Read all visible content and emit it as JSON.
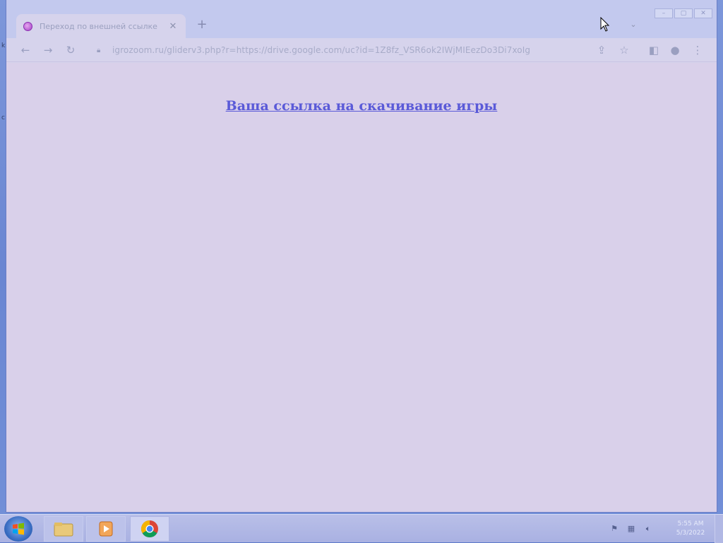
{
  "browser": {
    "tab": {
      "title": "Переход по внешней ссылке",
      "favicon_icon": "purple-circle-icon",
      "close_label": "✕"
    },
    "new_tab_label": "+",
    "tab_search_label": "⌄",
    "window_controls": {
      "minimize": "–",
      "maximize": "▢",
      "close": "✕"
    },
    "toolbar": {
      "back_label": "←",
      "forward_label": "→",
      "reload_label": "↻",
      "url": "igrozoom.ru/gliderv3.php?r=https://drive.google.com/uc?id=1Z8fz_VSR6ok2IWjMIEezDo3Di7xoIg",
      "share_label": "⇪",
      "bookmark_label": "☆",
      "sidepanel_label": "◧",
      "profile_label": "●",
      "menu_label": "⋮"
    }
  },
  "page": {
    "link_text": "Ваша ссылка на скачивание игры"
  },
  "taskbar": {
    "clock_time": "5:55 AM",
    "clock_date": "5/3/2022"
  },
  "colors": {
    "link": "#5a5ad8",
    "page_background": "#d9d0ea",
    "desktop": "#7390d8"
  }
}
